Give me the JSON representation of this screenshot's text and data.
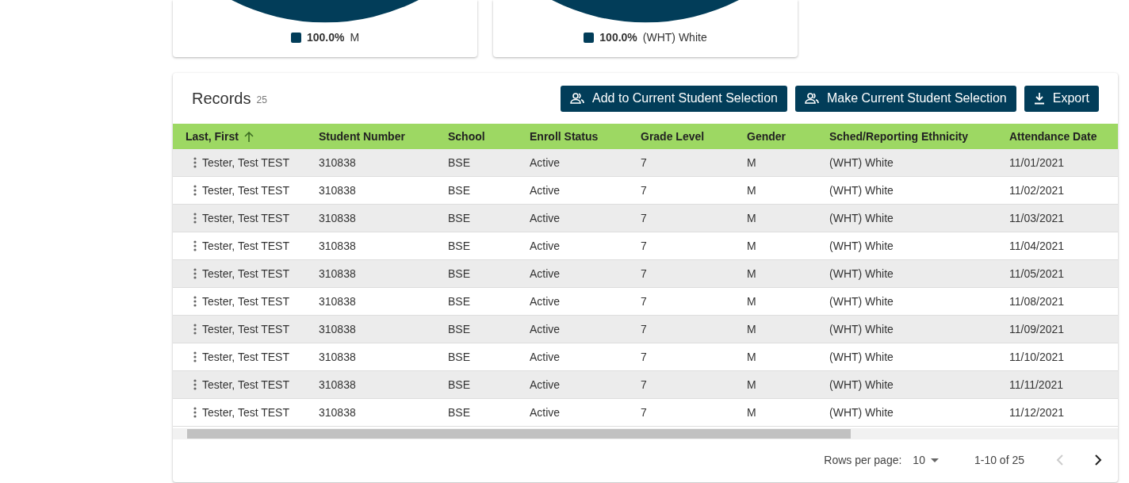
{
  "charts": [
    {
      "legend": [
        {
          "color": "#023d59",
          "percent": "100.0%",
          "label": "M"
        }
      ]
    },
    {
      "legend": [
        {
          "color": "#023d59",
          "percent": "100.0%",
          "label": "(WHT) White"
        }
      ]
    }
  ],
  "records": {
    "title": "Records",
    "count": "25",
    "buttons": [
      {
        "kind": "people",
        "label": "Add to Current Student Selection"
      },
      {
        "kind": "people",
        "label": "Make Current Student Selection"
      },
      {
        "kind": "download",
        "label": "Export"
      }
    ],
    "columns": [
      {
        "label": "Last, First",
        "sorted": true
      },
      {
        "label": "Student Number",
        "sorted": false
      },
      {
        "label": "School",
        "sorted": false
      },
      {
        "label": "Enroll Status",
        "sorted": false
      },
      {
        "label": "Grade Level",
        "sorted": false
      },
      {
        "label": "Gender",
        "sorted": false
      },
      {
        "label": "Sched/Reporting Ethnicity",
        "sorted": false
      },
      {
        "label": "Attendance Date",
        "sorted": false
      }
    ],
    "rows": [
      [
        "Tester, Test TEST",
        "310838",
        "BSE",
        "Active",
        "7",
        "M",
        "(WHT) White",
        "11/01/2021"
      ],
      [
        "Tester, Test TEST",
        "310838",
        "BSE",
        "Active",
        "7",
        "M",
        "(WHT) White",
        "11/02/2021"
      ],
      [
        "Tester, Test TEST",
        "310838",
        "BSE",
        "Active",
        "7",
        "M",
        "(WHT) White",
        "11/03/2021"
      ],
      [
        "Tester, Test TEST",
        "310838",
        "BSE",
        "Active",
        "7",
        "M",
        "(WHT) White",
        "11/04/2021"
      ],
      [
        "Tester, Test TEST",
        "310838",
        "BSE",
        "Active",
        "7",
        "M",
        "(WHT) White",
        "11/05/2021"
      ],
      [
        "Tester, Test TEST",
        "310838",
        "BSE",
        "Active",
        "7",
        "M",
        "(WHT) White",
        "11/08/2021"
      ],
      [
        "Tester, Test TEST",
        "310838",
        "BSE",
        "Active",
        "7",
        "M",
        "(WHT) White",
        "11/09/2021"
      ],
      [
        "Tester, Test TEST",
        "310838",
        "BSE",
        "Active",
        "7",
        "M",
        "(WHT) White",
        "11/10/2021"
      ],
      [
        "Tester, Test TEST",
        "310838",
        "BSE",
        "Active",
        "7",
        "M",
        "(WHT) White",
        "11/11/2021"
      ],
      [
        "Tester, Test TEST",
        "310838",
        "BSE",
        "Active",
        "7",
        "M",
        "(WHT) White",
        "11/12/2021"
      ]
    ],
    "pagination": {
      "rows_label": "Rows per page:",
      "rows_value": "10",
      "range": "1-10 of 25",
      "prev_disabled": true,
      "next_disabled": false
    }
  }
}
